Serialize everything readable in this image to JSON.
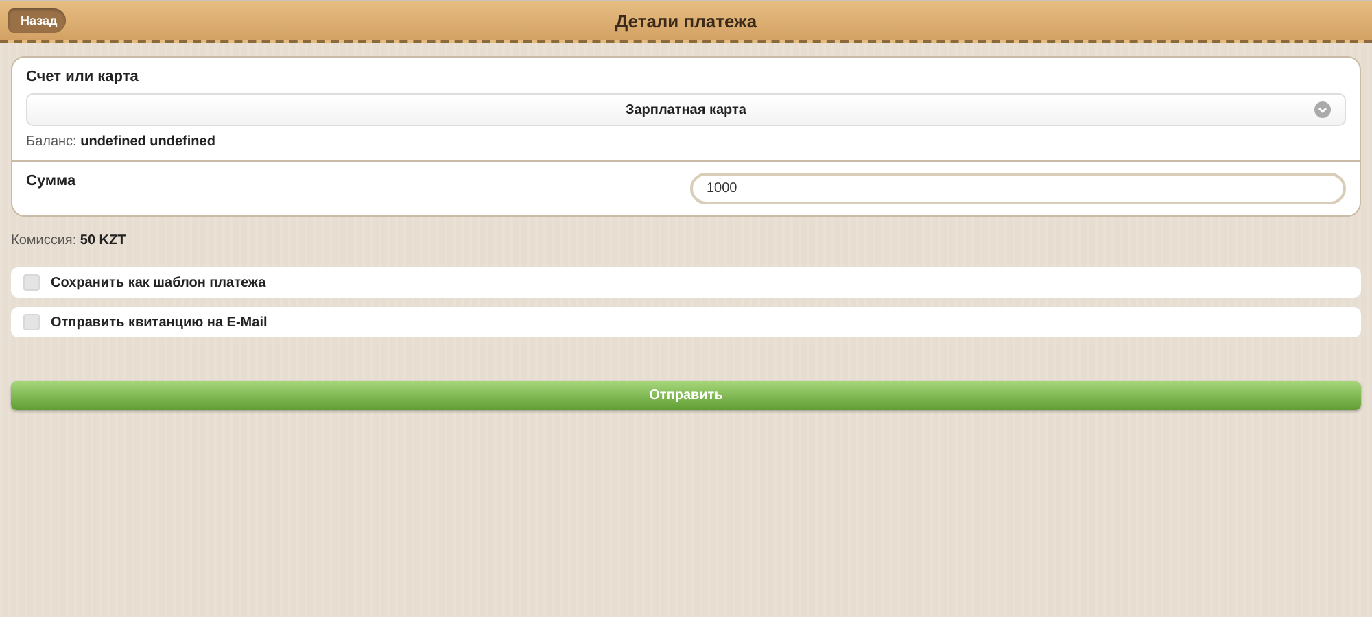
{
  "header": {
    "back": "Назад",
    "title": "Детали платежа"
  },
  "account": {
    "label": "Счет или карта",
    "value": "Зарплатная карта",
    "balance": "Баланс: **undefined undefined**"
  },
  "amount": {
    "label": "Сумма",
    "value": "1000"
  },
  "commission": "Комиссия: **50 KZT**",
  "options": [
    {
      "label": "Сохранить как шаблон платежа",
      "checked": false
    },
    {
      "label": "Отправить квитанцию на E-Mail",
      "checked": false
    }
  ],
  "submit": "Отправить"
}
